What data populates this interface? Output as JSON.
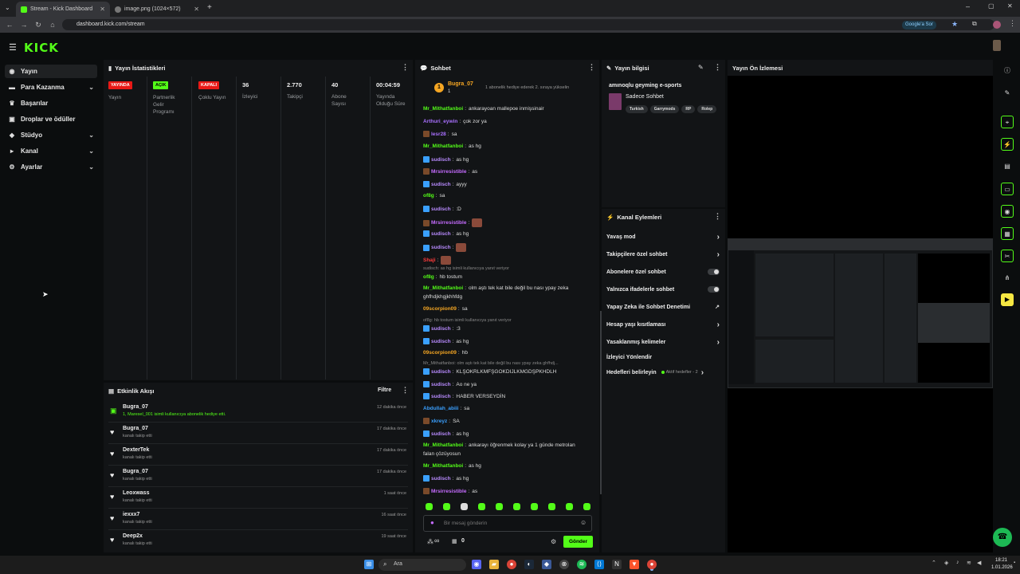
{
  "browser": {
    "tabs": [
      {
        "title": "Stream - Kick Dashboard"
      },
      {
        "title": "image.png (1024×572)"
      }
    ],
    "url": "dashboard.kick.com/stream",
    "google_btn": "Google'a Sor"
  },
  "header": {
    "logo": "KICK"
  },
  "sidebar": {
    "items": [
      {
        "label": "Yayın",
        "icon": "broadcast-icon"
      },
      {
        "label": "Para Kazanma",
        "icon": "money-icon"
      },
      {
        "label": "Başarılar",
        "icon": "trophy-icon"
      },
      {
        "label": "Droplar ve ödüller",
        "icon": "gift-icon"
      },
      {
        "label": "Stüdyo",
        "icon": "studio-icon"
      },
      {
        "label": "Kanal",
        "icon": "channel-icon"
      },
      {
        "label": "Ayarlar",
        "icon": "gear-icon"
      }
    ]
  },
  "stats": {
    "title": "Yayın İstatistikleri",
    "items": [
      {
        "badge": "YAYINDA",
        "label": "Yayın"
      },
      {
        "badge": "AÇIK",
        "label": "Partnerlik Gelir Programı"
      },
      {
        "badge": "KAPALI",
        "label": "Çoklu Yayın"
      },
      {
        "value": "36",
        "label": "İzleyici"
      },
      {
        "value": "2.770",
        "label": "Takipçi"
      },
      {
        "value": "40",
        "label": "Abone Sayısı"
      },
      {
        "value": "00:04:59",
        "label": "Yayında Olduğu Süre"
      }
    ]
  },
  "events": {
    "title": "Etkinlik Akışı",
    "filter": "Filtre",
    "items": [
      {
        "name": "Bugra_07",
        "sub": "1, Maresel_001 isimli kullanıcıya abonelik hediye etti.",
        "time": "12 dakika önce"
      },
      {
        "name": "Bugra_07",
        "sub": "kanalı takip etti",
        "time": "17 dakika önce"
      },
      {
        "name": "DexterTek",
        "sub": "kanalı takip etti",
        "time": "17 dakika önce"
      },
      {
        "name": "Bugra_07",
        "sub": "kanalı takip etti",
        "time": "17 dakika önce"
      },
      {
        "name": "Leoxwass",
        "sub": "kanalı takip etti",
        "time": "1 saat önce"
      },
      {
        "name": "iexxx7",
        "sub": "kanalı takip etti",
        "time": "16 saat önce"
      },
      {
        "name": "Deep2x",
        "sub": "kanalı takip etti",
        "time": "19 saat önce"
      }
    ]
  },
  "chat": {
    "title": "Sohbet",
    "pinned_user": "Bugra_07",
    "pinned_count": "1",
    "pinned_text": "1 abonelik hediye ederek 2. sıraya yükselin",
    "messages": [
      {
        "user": "Mr_Mithatfanboi",
        "text": "ankarayoan mallepoe inmişsinair",
        "color": "#53fc18"
      },
      {
        "user": "Arthuri_eywin",
        "text": "çok zor ya",
        "color": "#a970ff"
      },
      {
        "user": "lesr28",
        "text": "sa",
        "color": "#a970ff"
      },
      {
        "user": "Mr_Mithatfanboi",
        "text": "as hg",
        "color": "#53fc18"
      },
      {
        "user": "sudisch",
        "text": "as hg",
        "color": "#b98bff"
      },
      {
        "user": "Mrsirresistible",
        "text": "as",
        "color": "#c56cff"
      },
      {
        "user": "sudisch",
        "text": "ayyy",
        "color": "#b98bff"
      },
      {
        "user": "of8g",
        "text": "sa",
        "color": "#53fc18"
      },
      {
        "user": "sudisch",
        "text": ":D",
        "color": "#b98bff"
      },
      {
        "user": "Mrsirresistible",
        "text": "",
        "color": "#c56cff"
      },
      {
        "user": "sudisch",
        "text": "as hg",
        "color": "#b98bff"
      },
      {
        "user": "sudisch",
        "text": "",
        "color": "#b98bff"
      },
      {
        "user": "Shaji",
        "text": "",
        "color": "#ff3b3b"
      },
      {
        "sys": "sudisch: as hg isimli kullanıcıya yanıt veriyor"
      },
      {
        "user": "of8g",
        "text": "hb tostum",
        "color": "#53fc18"
      },
      {
        "user": "Mr_Mithatfanboi",
        "text": "olm aştı tek kat bile değil bu nası ypay zeka",
        "color": "#53fc18"
      },
      {
        "cont": "ghfhdjkhgjkhhfdg"
      },
      {
        "user": "09scorpion09",
        "text": "sa",
        "color": "#f5a623"
      },
      {
        "sys": "of8g: hb tostum isimli kullanıcıya yanıt veriyor"
      },
      {
        "user": "sudisch",
        "text": ":3",
        "color": "#b98bff"
      },
      {
        "user": "sudisch",
        "text": "as hg",
        "color": "#b98bff"
      },
      {
        "user": "09scorpion09",
        "text": "hb",
        "color": "#f5a623"
      },
      {
        "sys": "Mr_Mithatfanboi: olm aştı tek kat bile değil bu nası ypay zeka ghfhdj..."
      },
      {
        "user": "sudisch",
        "text": "KLŞOKRLKMFŞGOKDIJLKMGDŞPKHDLH",
        "color": "#b98bff"
      },
      {
        "user": "sudisch",
        "text": "Ao ne ya",
        "color": "#b98bff"
      },
      {
        "user": "sudisch",
        "text": "HABER VERSEYDİN",
        "color": "#b98bff"
      },
      {
        "user": "Abdullah_abiii",
        "text": "sa",
        "color": "#3aa0ff"
      },
      {
        "user": "xkreyz",
        "text": "SA",
        "color": "#3aa0ff"
      },
      {
        "user": "sudisch",
        "text": "as hg",
        "color": "#b98bff"
      },
      {
        "user": "Mr_Mithatfanboi",
        "text": "ankarayı öğrenmek kolay ya 1 günde metrolan",
        "color": "#53fc18"
      },
      {
        "cont": "falan çözüyosun"
      },
      {
        "user": "Mr_Mithatfanboi",
        "text": "as hg",
        "color": "#53fc18"
      },
      {
        "user": "sudisch",
        "text": "as hg",
        "color": "#b98bff"
      },
      {
        "user": "Mrsirresistible",
        "text": "as",
        "color": "#c56cff"
      }
    ],
    "input_placeholder": "Bir mesaj gönderin",
    "infinity": "∞",
    "box_count": "0",
    "send": "Gönder"
  },
  "stream_info": {
    "title": "Yayın bilgisi",
    "stream_title": "amınoqlu geyming e-sports",
    "category": "Sadece Sohbet",
    "tags": [
      "Turkish",
      "Garrymods",
      "RP",
      "Rolep"
    ]
  },
  "channel_actions": {
    "title": "Kanal Eylemleri",
    "items": [
      {
        "label": "Yavaş mod",
        "kind": "arrow"
      },
      {
        "label": "Takipçilere özel sohbet",
        "kind": "arrow"
      },
      {
        "label": "Abonelere özel sohbet",
        "kind": "toggle"
      },
      {
        "label": "Yalnızca ifadelerle sohbet",
        "kind": "toggle"
      },
      {
        "label": "Yapay Zeka ile Sohbet Denetimi",
        "kind": "ext"
      },
      {
        "label": "Hesap yaşı kısıtlaması",
        "kind": "arrow"
      },
      {
        "label": "Yasaklanmış kelimeler",
        "kind": "arrow"
      },
      {
        "label": "İzleyici Yönlendir",
        "kind": "none"
      },
      {
        "label": "Hedefleri belirleyin",
        "kind": "goal",
        "extra": "Aktif hedefler - 2"
      }
    ]
  },
  "preview": {
    "title": "Yayın Ön İzlemesi"
  },
  "taskbar": {
    "search": "Ara",
    "time": "18:21",
    "date": "1.01.2026"
  },
  "colors": {
    "brand": "#53fc18",
    "live": "#e91916"
  }
}
